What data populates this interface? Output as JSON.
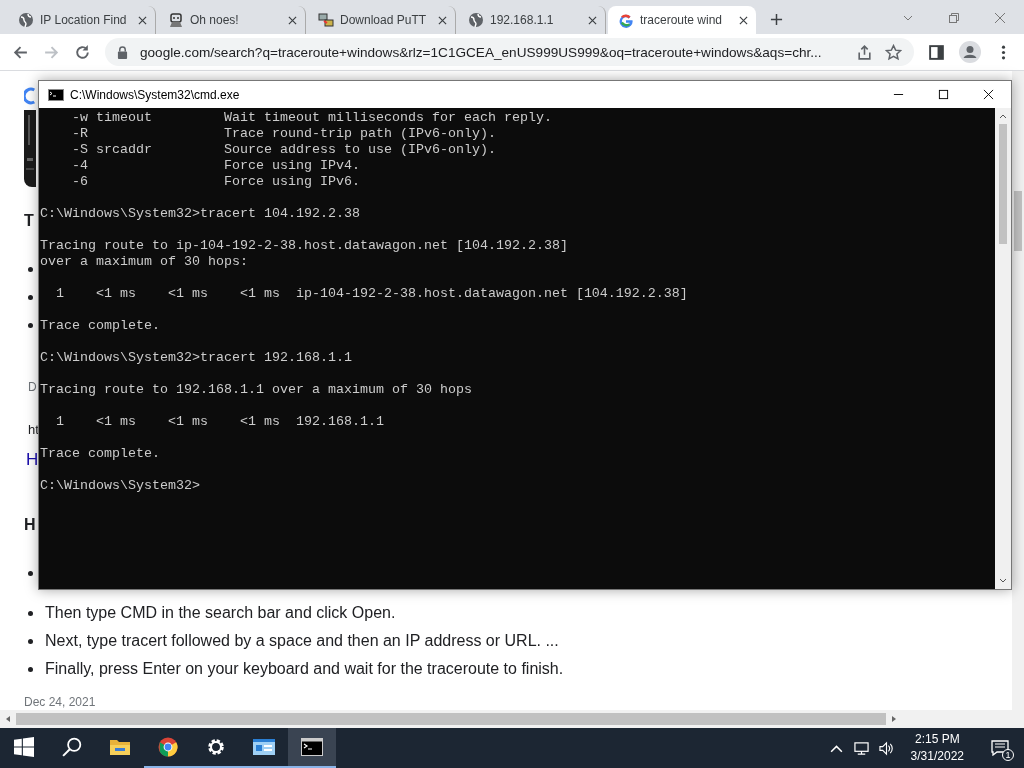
{
  "browser": {
    "tabs": [
      {
        "title": "IP Location Find",
        "kind": "globe",
        "selected": false
      },
      {
        "title": "Oh noes!",
        "kind": "robot",
        "selected": false
      },
      {
        "title": "Download PuTT",
        "kind": "computers",
        "selected": false
      },
      {
        "title": "192.168.1.1",
        "kind": "globe",
        "selected": false
      },
      {
        "title": "traceroute wind",
        "kind": "google",
        "selected": true
      }
    ],
    "address": "google.com/search?q=traceroute+windows&rlz=1C1GCEA_enUS999US999&oq=traceroute+windows&aqs=chr..."
  },
  "page": {
    "items": [
      {
        "kind": "heading",
        "text": "T"
      },
      {
        "kind": "bullet"
      },
      {
        "kind": "bullet"
      },
      {
        "kind": "bullet"
      },
      {
        "kind": "small",
        "text": "D"
      },
      {
        "kind": "url",
        "text": "ht"
      },
      {
        "kind": "link",
        "text": "H"
      },
      {
        "kind": "heading",
        "text": "H"
      },
      {
        "kind": "bullet"
      },
      {
        "kind": "list_item",
        "text": "Then type CMD in the search bar and click Open."
      },
      {
        "kind": "list_item",
        "text": "Next, type tracert followed by a space and then an IP address or URL. ..."
      },
      {
        "kind": "list_item",
        "text": "Finally, press Enter on your keyboard and wait for the traceroute to finish."
      },
      {
        "kind": "date",
        "text": "Dec 24, 2021"
      }
    ]
  },
  "console_window": {
    "title": "C:\\Windows\\System32\\cmd.exe",
    "blocks": [
      [
        "    -w timeout         Wait timeout milliseconds for each reply.",
        "    -R                 Trace round-trip path (IPv6-only).",
        "    -S srcaddr         Source address to use (IPv6-only).",
        "    -4                 Force using IPv4.",
        "    -6                 Force using IPv6."
      ],
      [
        "C:\\Windows\\System32>tracert 104.192.2.38"
      ],
      [
        "Tracing route to ip-104-192-2-38.host.datawagon.net [104.192.2.38]",
        "over a maximum of 30 hops:"
      ],
      [
        "  1    <1 ms    <1 ms    <1 ms  ip-104-192-2-38.host.datawagon.net [104.192.2.38]"
      ],
      [
        "Trace complete."
      ],
      [
        "C:\\Windows\\System32>tracert 192.168.1.1"
      ],
      [
        "Tracing route to 192.168.1.1 over a maximum of 30 hops"
      ],
      [
        "  1    <1 ms    <1 ms    <1 ms  192.168.1.1"
      ],
      [
        "Trace complete."
      ],
      [
        "C:\\Windows\\System32>"
      ]
    ]
  },
  "taskbar": {
    "apps": [
      {
        "kind": "start",
        "running": false,
        "selected": false
      },
      {
        "kind": "search",
        "running": false,
        "selected": false
      },
      {
        "kind": "folder",
        "running": false,
        "selected": false
      },
      {
        "kind": "chrome",
        "running": true,
        "selected": false
      },
      {
        "kind": "gear",
        "running": true,
        "selected": false
      },
      {
        "kind": "window",
        "running": true,
        "selected": false
      },
      {
        "kind": "terminal",
        "running": true,
        "selected": true
      }
    ],
    "time": "2:15 PM",
    "date": "3/31/2022",
    "notifications": "1"
  }
}
